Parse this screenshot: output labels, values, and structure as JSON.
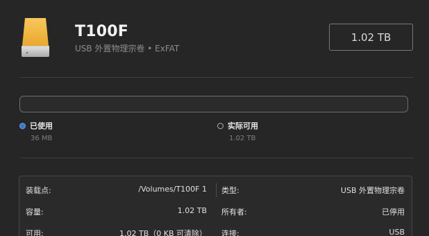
{
  "header": {
    "title": "T100F",
    "subtitle": "USB 外置物理宗卷 • ExFAT",
    "capacity": "1.02 TB",
    "icon": "external-drive-icon",
    "icon_color": "#f2b53a"
  },
  "usage": {
    "used_fraction": 4e-05,
    "used_color": "#3a78c7",
    "legend": [
      {
        "label": "已使用",
        "value": "36 MB"
      },
      {
        "label": "实际可用",
        "value": "1.02 TB"
      }
    ]
  },
  "info": {
    "left": [
      {
        "label": "装载点:",
        "value": "/Volumes/T100F 1"
      },
      {
        "label": "容量:",
        "value": "1.02 TB"
      },
      {
        "label": "可用:",
        "value": "1.02 TB（0 KB 可清除）"
      }
    ],
    "right": [
      {
        "label": "类型:",
        "value": "USB 外置物理宗卷"
      },
      {
        "label": "所有者:",
        "value": "已停用"
      },
      {
        "label": "连接:",
        "value": "USB"
      }
    ]
  }
}
